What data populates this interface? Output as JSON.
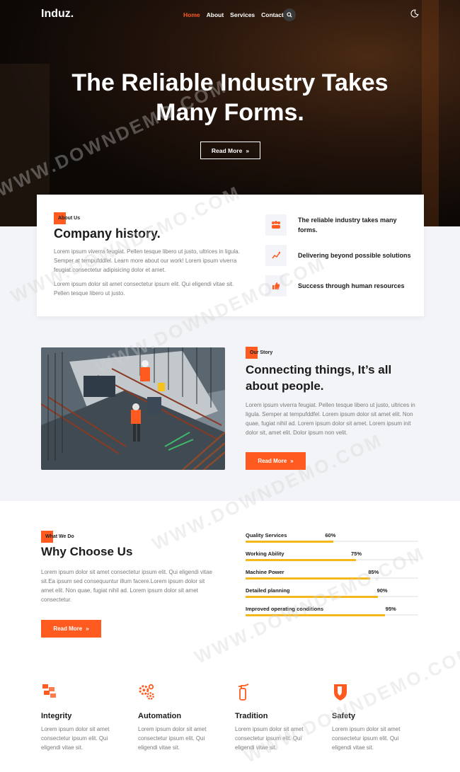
{
  "nav": {
    "logo": "Induz.",
    "items": [
      "Home",
      "About",
      "Services",
      "Contact"
    ],
    "active_color": "#ff5a1f"
  },
  "hero": {
    "title_line1": "The Reliable Industry Takes",
    "title_line2": "Many Forms.",
    "button": "Read More"
  },
  "about": {
    "tag": "About Us",
    "title": "Company history.",
    "para1": "Lorem ipsum viverra feugiat. Pellen tesque libero ut justo, ultrices in ligula. Semper at tempufddfel. Learn more about our work! Lorem ipsum viverra feugiat.consectetur adipisicing dolor et amet.",
    "para2": "Lorem ipsum dolor sit amet consectetur ipsum elit. Qui eligendi vitae sit. Pellen tesque libero ut justo.",
    "features": [
      {
        "icon": "team-icon",
        "text": "The reliable industry takes many forms."
      },
      {
        "icon": "chart-icon",
        "text": "Delivering beyond possible solutions"
      },
      {
        "icon": "thumbs-up-icon",
        "text": "Success through human resources"
      }
    ]
  },
  "story": {
    "tag": "Our Story",
    "title_line1": "Connecting things, It’s all",
    "title_line2": "about people.",
    "para": "Lorem ipsum viverra feugiat. Pellen tesque libero ut justo, ultrices in ligula. Semper at tempufddfel. Lorem ipsum dolor sit amet elit. Non quae, fugiat nihil ad. Lorem ipsum dolor sit amet. Lorem ipsum init dolor sit, amet elit. Dolor ipsum non velit.",
    "button": "Read More"
  },
  "why": {
    "tag": "What We Do",
    "title": "Why Choose Us",
    "para": "Lorem ipsum dolor sit amet consectetur ipsum elit. Qui eligendi vitae sit.Ea ipsum sed consequuntur illum facere.Lorem ipsum dolor sit amet elit. Non quae, fugiat nihil ad. Lorem ipsum dolor sit amet consectetur.",
    "button": "Read More",
    "skills": [
      {
        "label": "Quality Services",
        "value": 60,
        "pct": "60%"
      },
      {
        "label": "Working Ability",
        "value": 75,
        "pct": "75%"
      },
      {
        "label": "Machine Power",
        "value": 85,
        "pct": "85%"
      },
      {
        "label": "Detailed planning",
        "value": 90,
        "pct": "90%"
      },
      {
        "label": "Improved operating conditions",
        "value": 95,
        "pct": "95%"
      }
    ],
    "bar_color": "#f5b81c"
  },
  "values": [
    {
      "icon": "blocks-icon",
      "title": "Integrity",
      "text": "Lorem ipsum dolor sit amet consectetur ipsum elit. Qui eligendi vitae sit."
    },
    {
      "icon": "gears-icon",
      "title": "Automation",
      "text": "Lorem ipsum dolor sit amet consectetur ipsum elit. Qui eligendi vitae sit."
    },
    {
      "icon": "fire-extinguisher-icon",
      "title": "Tradition",
      "text": "Lorem ipsum dolor sit amet consectetur ipsum elit. Qui eligendi vitae sit."
    },
    {
      "icon": "shield-icon",
      "title": "Safety",
      "text": "Lorem ipsum dolor sit amet consectetur ipsum elit. Qui eligendi vitae sit."
    }
  ],
  "watermark": "WWW.DOWNDEMO.COM",
  "accent": "#ff5a1f"
}
